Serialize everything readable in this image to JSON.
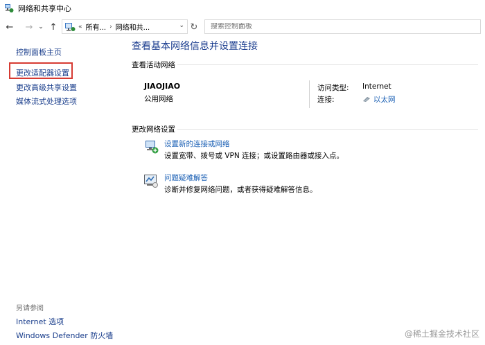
{
  "window": {
    "title": "网络和共享中心"
  },
  "addressbar": {
    "crumbs": [
      "所有...",
      "网络和共..."
    ],
    "search_placeholder": "搜索控制面板"
  },
  "sidebar": {
    "items": [
      "控制面板主页",
      "更改适配器设置",
      "更改高级共享设置",
      "媒体流式处理选项"
    ],
    "see_also_title": "另请参阅",
    "see_also": [
      "Internet 选项",
      "Windows Defender 防火墙"
    ]
  },
  "main": {
    "heading": "查看基本网络信息并设置连接",
    "active_networks_label": "查看活动网络",
    "network": {
      "name": "JIAOJIAO",
      "category": "公用网络",
      "access_type_label": "访问类型:",
      "access_type_value": "Internet",
      "connections_label": "连接:",
      "connections_value": "以太网"
    },
    "change_settings_label": "更改网络设置",
    "tasks": [
      {
        "title": "设置新的连接或网络",
        "desc": "设置宽带、拨号或 VPN 连接；或设置路由器或接入点。"
      },
      {
        "title": "问题疑难解答",
        "desc": "诊断并修复网络问题，或者获得疑难解答信息。"
      }
    ]
  },
  "watermark": "@稀土掘金技术社区",
  "colors": {
    "link": "#1a5fb4",
    "heading": "#1b3d8f",
    "highlight": "#d63a32"
  }
}
